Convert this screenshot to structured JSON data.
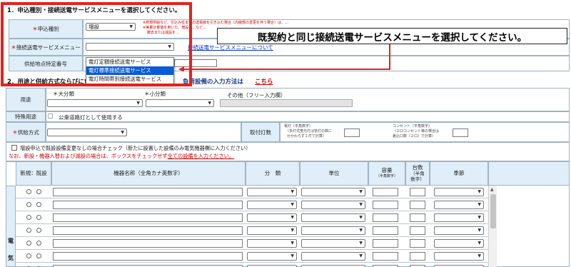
{
  "section1": {
    "title": "1．申込種別・接続送電サービスメニューを選択してください。",
    "application_type_label": "申込種別",
    "application_type_value": "増設",
    "notes": [
      "※新規供給など、引込み柱までの送電線を引き込む場合（内線部の変更を伴う場合）は、…",
      "※実量計量値を用いた、増設・…など…",
      "撤去または減設を…"
    ],
    "service_menu_label": "接続送電サービスメニュー",
    "service_menu_value": "",
    "service_menu_link": "接続送電サービスメニューについて",
    "supply_point_label": "供給地点特定番号",
    "required_mark": "＊",
    "dropdown_options": [
      "電灯定額接続送電サービス",
      "電灯標準接続送電サービス",
      "電灯時間帯別接続送電サービス"
    ],
    "highlighted_option_index": 1
  },
  "callout": {
    "text": "既契約と同じ接続送電サービスメニューを選択してください。"
  },
  "section2": {
    "title": "2．用途と供給方式ならびに負",
    "title_suffix": "負荷設備の入力方法は",
    "link": "こちら",
    "usage_label": "用途",
    "major_category": "＊大分類",
    "minor_category": "＊小分類",
    "other_label": "その他（フリー入力欄）",
    "special_use_label": "特殊用途",
    "special_use_option": "公衆道路灯として使用する",
    "supply_method_label": "供給方式",
    "fixture_count_label": "取付灯数",
    "lamp_note": [
      "電灯（平角数字）",
      "（多灯式蛍光灯は管灯の数に",
      "かかわらず１灯で計算）"
    ],
    "outlet_note": [
      "コンセント（平角数字）",
      "（２口コンセント等の場合は",
      "差込口数（２口）で計算）"
    ],
    "check_note": "増設申込で既設設備変更なしの場合チェック（新たに設置した設備のみ電気機器欄に入力ください）",
    "warning_prefix": "なお、新設・機器入替および減設の場合は、ボックスをチェックせず",
    "warning_emph": "全ての設備を入力ください。",
    "table_headers": {
      "new_existing": "新規：既設",
      "device_name": "機器名称（全角カナ英数字）",
      "classification": "分　類",
      "unit": "単位",
      "capacity": "容量",
      "capacity_sub": "（半角数字）",
      "count": "台数",
      "count_sub": "（半角",
      "count_sub2": "数字）",
      "season": "季節"
    },
    "side_label": [
      "電",
      "気"
    ]
  },
  "colors": {
    "highlight_box": "#e8201a",
    "header_bg": "#dfeef8",
    "select_highlight": "#0a5bd6"
  }
}
